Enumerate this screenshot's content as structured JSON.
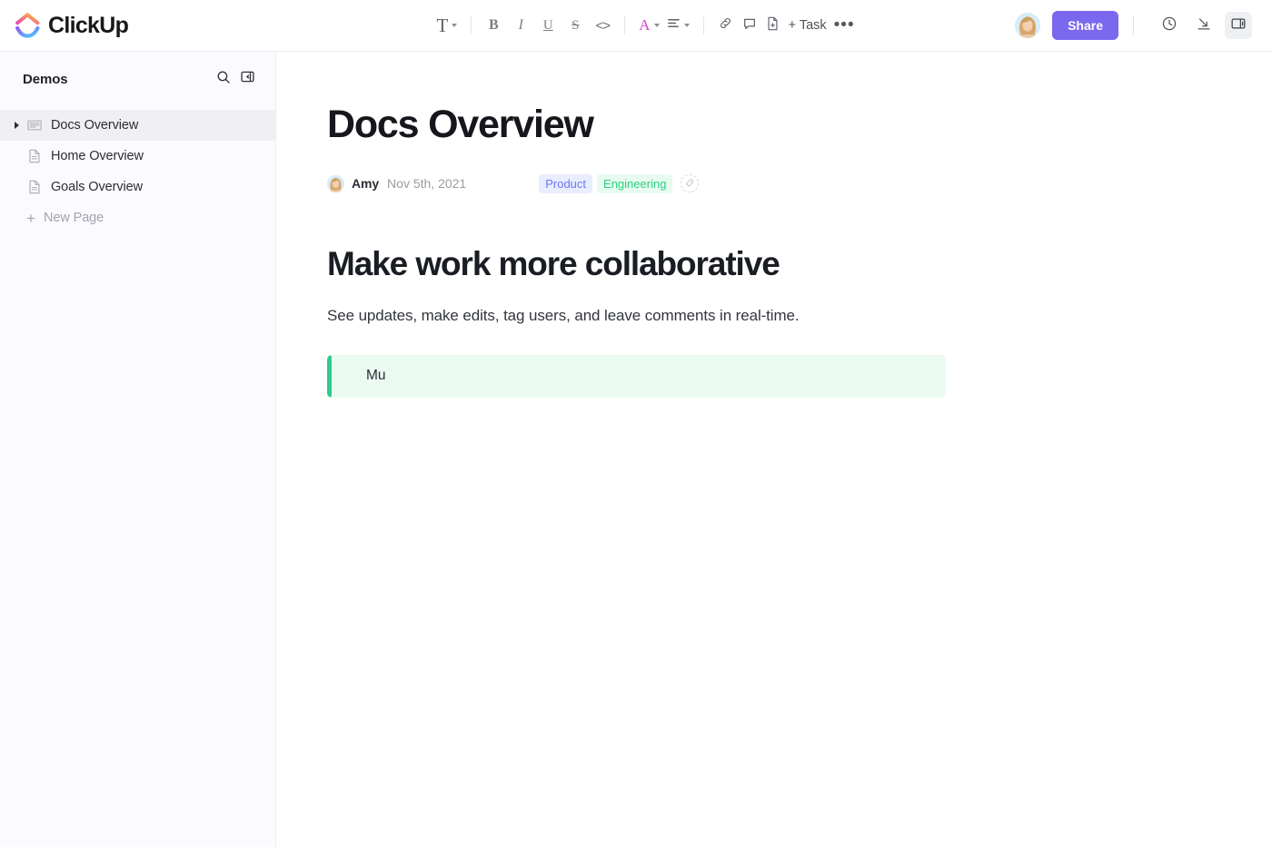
{
  "app": {
    "brand_name": "ClickUp"
  },
  "toolbar": {
    "text_style_glyph": "T",
    "bold_glyph": "B",
    "italic_glyph": "I",
    "underline_glyph": "U",
    "strike_glyph": "S",
    "code_glyph": "<>",
    "font_color_glyph": "A",
    "task_label": "+ Task",
    "more_glyph": "•••",
    "icons": {
      "link": "link-icon",
      "comment": "comment-icon",
      "page": "page-add-icon",
      "align": "align-left-icon"
    }
  },
  "top_right": {
    "share_label": "Share",
    "avatar_name": "Amy",
    "history_icon": "clock-icon",
    "collapse_icon": "arrow-to-line-icon",
    "panel_icon": "right-panel-icon"
  },
  "sidebar": {
    "title": "Demos",
    "search_icon": "search-icon",
    "collapse_icon": "collapse-panel-icon",
    "items": [
      {
        "label": "Docs Overview",
        "icon": "doc-lines-icon",
        "active": true,
        "expandable": true
      },
      {
        "label": "Home Overview",
        "icon": "page-icon",
        "active": false,
        "expandable": false
      },
      {
        "label": "Goals Overview",
        "icon": "page-icon",
        "active": false,
        "expandable": false
      }
    ],
    "new_page_label": "New Page",
    "new_page_icon": "plus-icon"
  },
  "document": {
    "title": "Docs Overview",
    "author": "Amy",
    "date": "Nov 5th, 2021",
    "tags": [
      {
        "label": "Product",
        "bg": "#e9edfd",
        "color": "#6979f8"
      },
      {
        "label": "Engineering",
        "bg": "#e7fbf0",
        "color": "#2dd07f"
      }
    ],
    "add_tag_icon": "tag-add-icon",
    "heading": "Make work more collaborative",
    "paragraph": "See updates, make edits, tag users, and leave comments in real-time.",
    "callout": {
      "text": "Mu",
      "accent": "#2ecb8b",
      "background": "#ebfbf2"
    }
  },
  "colors": {
    "brand_purple": "#7b68ee",
    "accent_pink": "#d745d0",
    "sidebar_bg": "#fbfaff"
  }
}
